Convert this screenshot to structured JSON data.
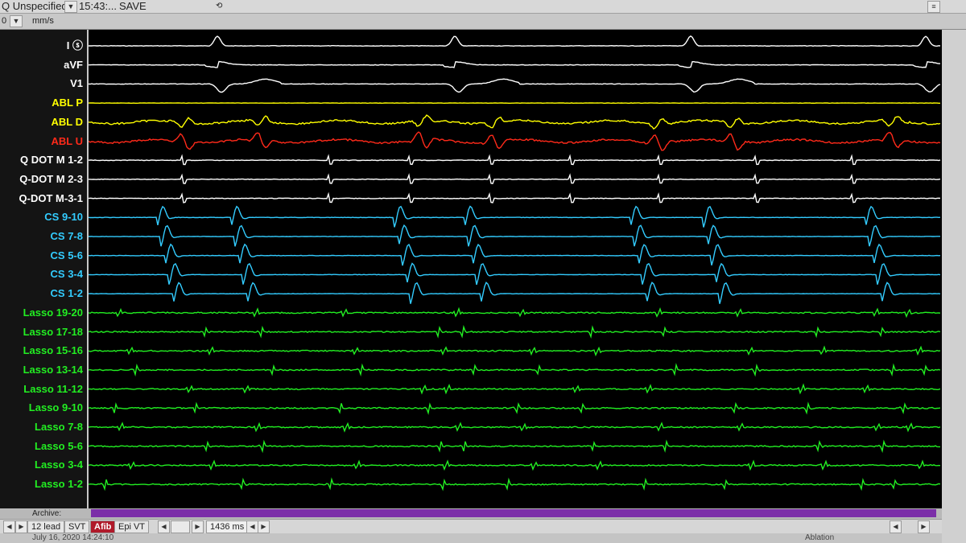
{
  "header": {
    "view_name": "Q Unspecified",
    "time": "15:43:...",
    "save_label": "SAVE",
    "speed_value": "0",
    "speed_unit": "mm/s"
  },
  "channels": [
    {
      "label": "I ⓢ",
      "color": "#ffffff"
    },
    {
      "label": "aVF",
      "color": "#ffffff"
    },
    {
      "label": "V1",
      "color": "#ffffff"
    },
    {
      "label": "ABL P",
      "color": "#ffff00"
    },
    {
      "label": "ABL D",
      "color": "#ffff00"
    },
    {
      "label": "ABL U",
      "color": "#ff2a1a"
    },
    {
      "label": "Q DOT M 1-2",
      "color": "#ffffff"
    },
    {
      "label": "Q-DOT M 2-3",
      "color": "#ffffff"
    },
    {
      "label": "Q-DOT M-3-1",
      "color": "#ffffff"
    },
    {
      "label": "CS 9-10",
      "color": "#33ccff"
    },
    {
      "label": "CS 7-8",
      "color": "#33ccff"
    },
    {
      "label": "CS 5-6",
      "color": "#33ccff"
    },
    {
      "label": "CS 3-4",
      "color": "#33ccff"
    },
    {
      "label": "CS 1-2",
      "color": "#33ccff"
    },
    {
      "label": "Lasso 19-20",
      "color": "#22ee22"
    },
    {
      "label": "Lasso 17-18",
      "color": "#22ee22"
    },
    {
      "label": "Lasso 15-16",
      "color": "#22ee22"
    },
    {
      "label": "Lasso 13-14",
      "color": "#22ee22"
    },
    {
      "label": "Lasso 11-12",
      "color": "#22ee22"
    },
    {
      "label": "Lasso 9-10",
      "color": "#22ee22"
    },
    {
      "label": "Lasso 7-8",
      "color": "#22ee22"
    },
    {
      "label": "Lasso 5-6",
      "color": "#22ee22"
    },
    {
      "label": "Lasso 3-4",
      "color": "#22ee22"
    },
    {
      "label": "Lasso 1-2",
      "color": "#22ee22"
    }
  ],
  "archive": {
    "label": "Archive:"
  },
  "tabs": [
    {
      "label": "12 lead",
      "active": false
    },
    {
      "label": "SVT",
      "active": false
    },
    {
      "label": "Afib",
      "active": true
    },
    {
      "label": "Epi VT",
      "active": false
    }
  ],
  "timebase": {
    "value": "1436 ms"
  },
  "status": {
    "left_text": "July 16, 2020  14:24:10",
    "right_text": "Ablation"
  },
  "colors": {
    "accent_tab": "#b01a2a",
    "archive_bar": "#7b2ea8"
  }
}
